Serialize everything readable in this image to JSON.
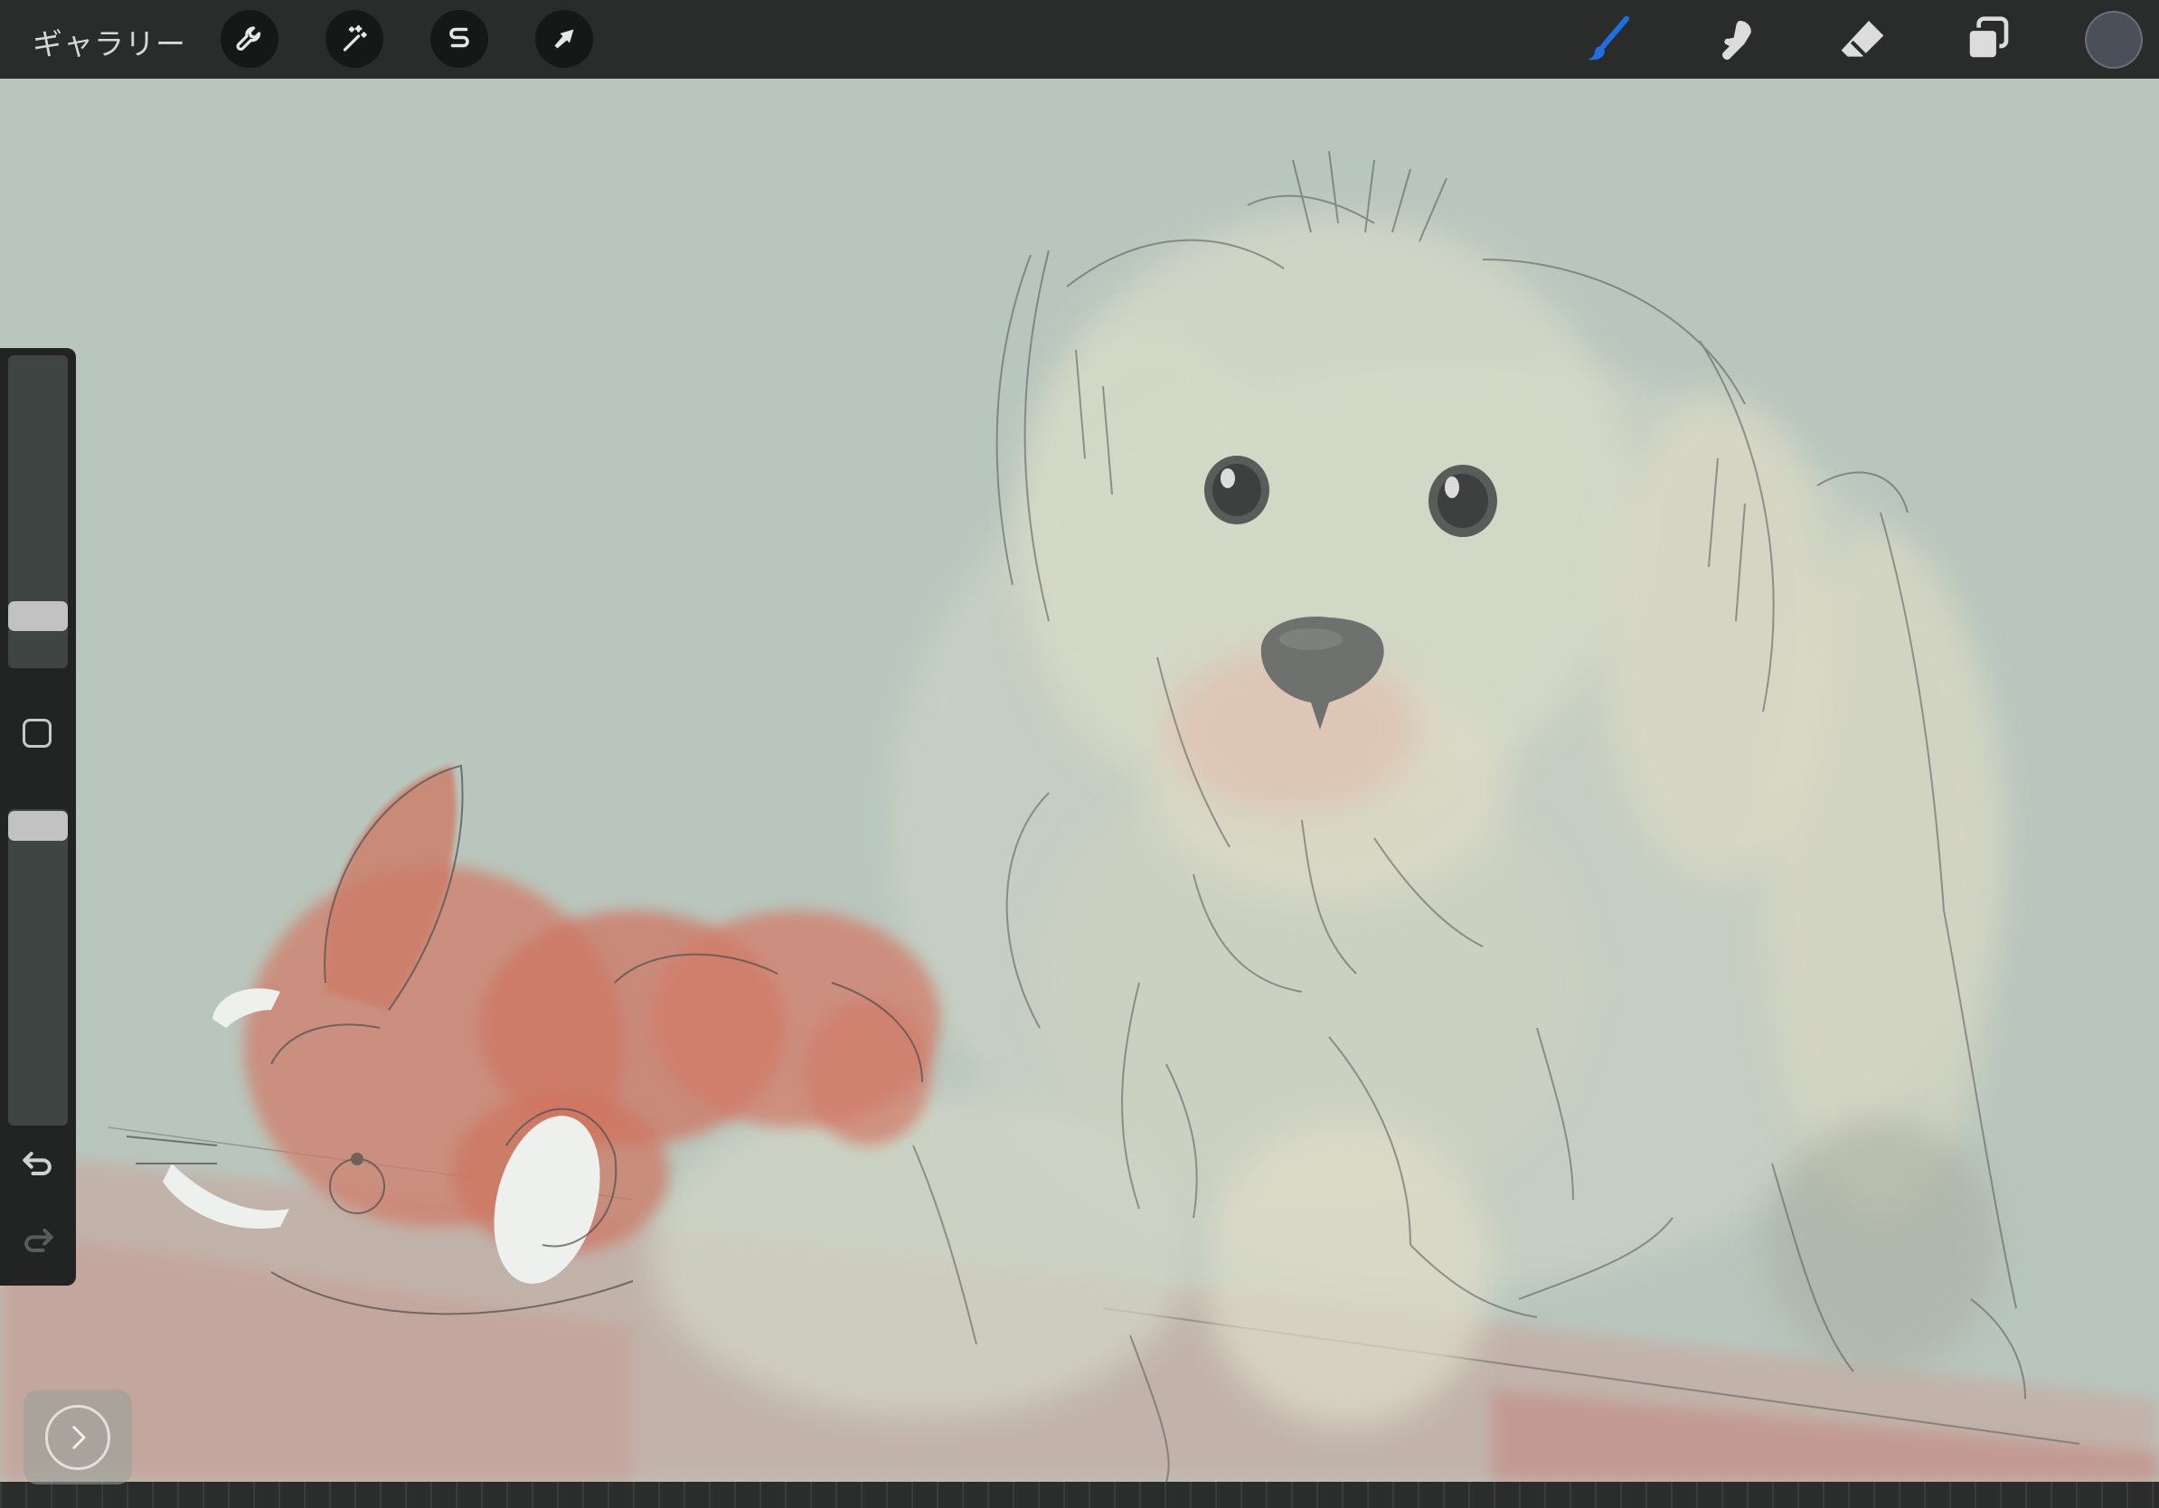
{
  "app": {
    "name": "Procreate"
  },
  "topbar": {
    "gallery_label": "ギャラリー",
    "left_tools": [
      {
        "name": "actions",
        "icon": "wrench-icon"
      },
      {
        "name": "adjustments",
        "icon": "magic-wand-icon"
      },
      {
        "name": "selection",
        "icon": "selection-s-icon"
      },
      {
        "name": "transform",
        "icon": "arrow-cursor-icon"
      }
    ],
    "right_tools": [
      {
        "name": "brush",
        "icon": "brush-icon",
        "active": true
      },
      {
        "name": "smudge",
        "icon": "smudge-finger-icon",
        "active": false
      },
      {
        "name": "eraser",
        "icon": "eraser-icon",
        "active": false
      },
      {
        "name": "layers",
        "icon": "layers-icon",
        "active": false
      }
    ],
    "current_color": "#4b4f5a"
  },
  "sidebar": {
    "brush_size_level": 0.13,
    "opacity_level": 0.96,
    "icons": [
      "modify-square-icon",
      "undo-icon",
      "redo-icon"
    ]
  },
  "canvas": {
    "background_color": "#b9c6bd"
  },
  "quick_menu": {
    "icon": "chevron-right-icon"
  },
  "colors": {
    "accent": "#1f6fe0",
    "ui_dark": "#2a2b2b"
  }
}
